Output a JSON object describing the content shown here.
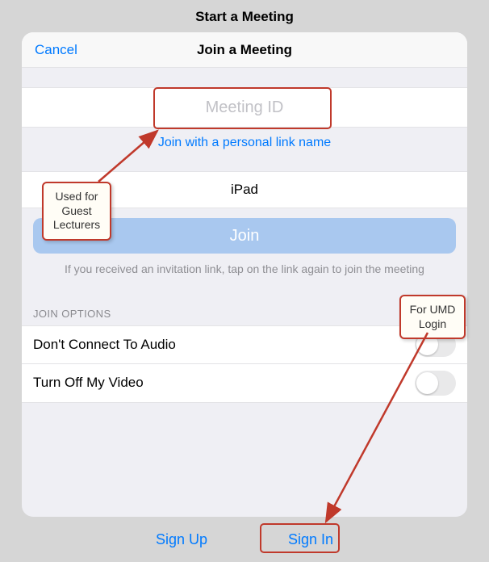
{
  "page": {
    "title": "Start a Meeting"
  },
  "modal": {
    "cancel": "Cancel",
    "title": "Join a Meeting",
    "meetingId": {
      "placeholder": "Meeting ID",
      "value": ""
    },
    "personalLink": "Join with a personal link name",
    "displayName": "iPad",
    "joinLabel": "Join",
    "hint": "If you received an invitation link, tap on the link again to join the meeting",
    "optionsHeader": "JOIN OPTIONS",
    "options": [
      {
        "label": "Don't Connect To Audio",
        "on": false
      },
      {
        "label": "Turn Off My Video",
        "on": false
      }
    ]
  },
  "bottom": {
    "signUp": "Sign Up",
    "signIn": "Sign In"
  },
  "annotations": {
    "guest": "Used for Guest Lecturers",
    "umd": "For UMD Login"
  },
  "colors": {
    "link": "#007aff",
    "annotation": "#c0392b"
  }
}
